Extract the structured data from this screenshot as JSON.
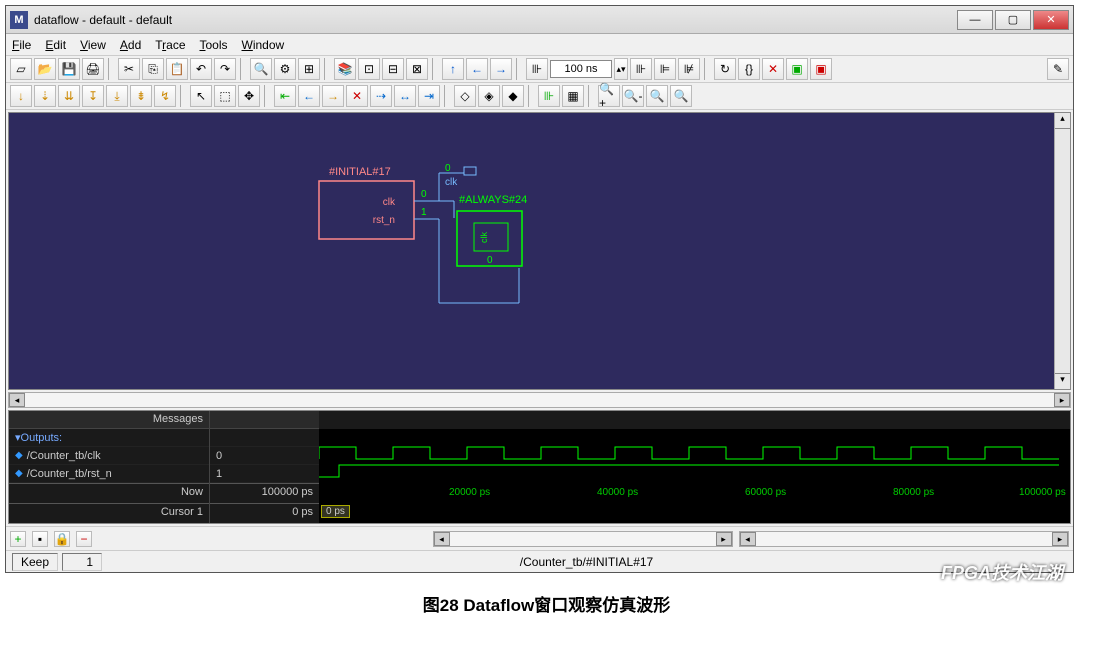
{
  "window": {
    "title": "dataflow - default - default",
    "app_icon": "M"
  },
  "menu": [
    "File",
    "Edit",
    "View",
    "Add",
    "Trace",
    "Tools",
    "Window"
  ],
  "toolbar": {
    "time_value": "100 ns"
  },
  "dataflow": {
    "initial_label": "#INITIAL#17",
    "always_label": "#ALWAYS#24",
    "port_clk": "clk",
    "port_rst": "rst_n",
    "val0": "0",
    "val1": "1"
  },
  "wave": {
    "messages_header": "Messages",
    "outputs_label": "Outputs:",
    "signals": [
      {
        "name": "/Counter_tb/clk",
        "value": "0"
      },
      {
        "name": "/Counter_tb/rst_n",
        "value": "1"
      }
    ],
    "now_label": "Now",
    "now_value": "100000 ps",
    "cursor_label": "Cursor 1",
    "cursor_value": "0 ps",
    "cursor_box": "0 ps",
    "ticks": [
      "20000 ps",
      "40000 ps",
      "60000 ps",
      "80000 ps",
      "100000 ps"
    ]
  },
  "bottom": {
    "keep": "Keep",
    "keep_val": "1"
  },
  "status": {
    "path": "/Counter_tb/#INITIAL#17"
  },
  "caption": "图28 Dataflow窗口观察仿真波形",
  "watermark": "FPGA技术江湖"
}
